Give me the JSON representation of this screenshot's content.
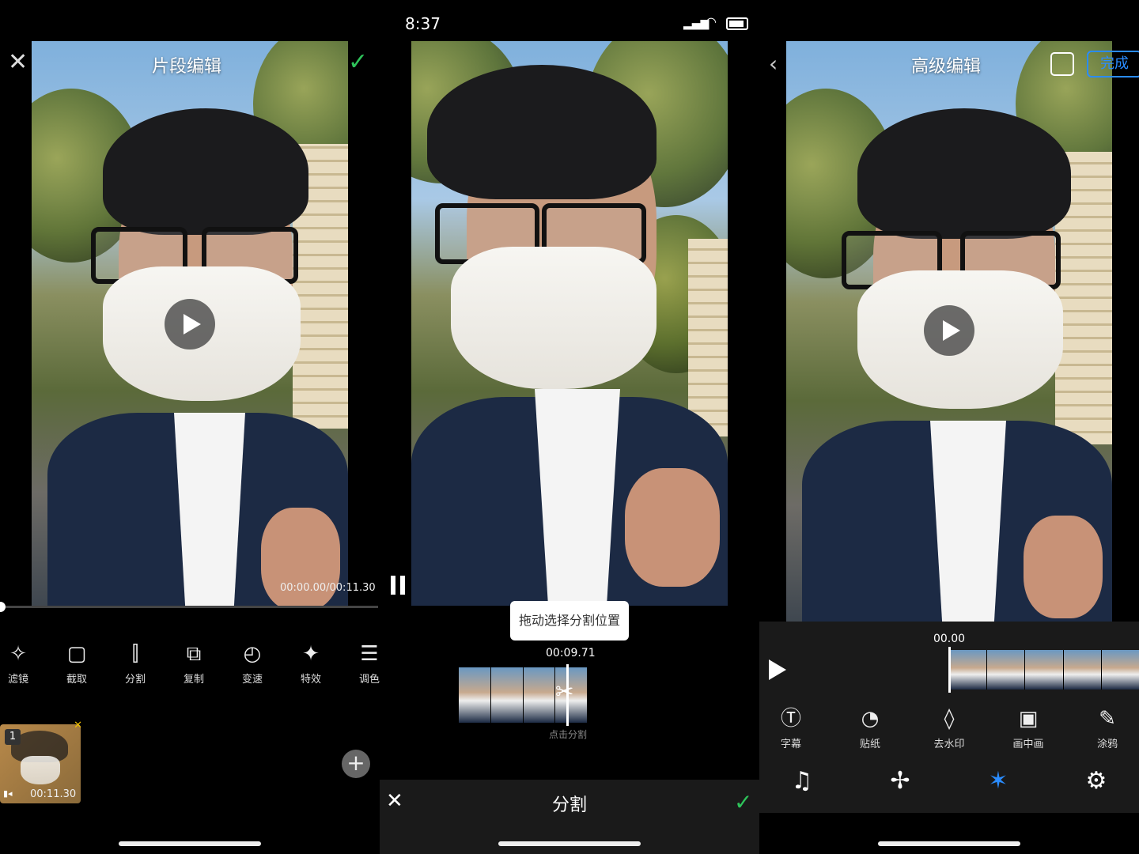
{
  "panel1": {
    "title": "片段编辑",
    "close_icon": "close-icon",
    "confirm_icon": "check-icon",
    "timecode": "00:00.00/00:11.30",
    "progress": 0.0,
    "tools": [
      {
        "label": "滤镜",
        "icon": "filter-wand-icon",
        "glyph": "✧"
      },
      {
        "label": "截取",
        "icon": "crop-icon",
        "glyph": "▢"
      },
      {
        "label": "分割",
        "icon": "split-icon",
        "glyph": "⫿"
      },
      {
        "label": "复制",
        "icon": "copy-icon",
        "glyph": "⧉"
      },
      {
        "label": "变速",
        "icon": "speed-icon",
        "glyph": "◴"
      },
      {
        "label": "特效",
        "icon": "effects-icon",
        "glyph": "✦"
      },
      {
        "label": "调色",
        "icon": "adjust-icon",
        "glyph": "☰"
      }
    ],
    "clip": {
      "index": "1",
      "duration": "00:11.30"
    },
    "add_icon": "plus-icon"
  },
  "panel2": {
    "status_time": "8:37",
    "hint": "拖动选择分割位置",
    "timecode": "00:09.71",
    "tap_hint": "点击分割",
    "title": "分割",
    "close_icon": "close-icon",
    "confirm_icon": "check-icon"
  },
  "panel3": {
    "title": "高级编辑",
    "back_icon": "chevron-left-icon",
    "save_icon": "save-icon",
    "done": "完成",
    "timecode": "00.00",
    "tools": [
      {
        "label": "字幕",
        "icon": "subtitle-icon",
        "glyph": "Ⓣ"
      },
      {
        "label": "贴纸",
        "icon": "sticker-icon",
        "glyph": "◔"
      },
      {
        "label": "去水印",
        "icon": "drop-icon",
        "glyph": "◊"
      },
      {
        "label": "画中画",
        "icon": "pip-icon",
        "glyph": "▣"
      },
      {
        "label": "涂鸦",
        "icon": "brush-icon",
        "glyph": "✎"
      }
    ],
    "bottom_tabs": [
      {
        "icon": "music-icon",
        "glyph": "♫",
        "active": false
      },
      {
        "icon": "transition-icon",
        "glyph": "✢",
        "active": false
      },
      {
        "icon": "magic-wand-icon",
        "glyph": "✶",
        "active": true
      },
      {
        "icon": "settings-icon",
        "glyph": "⚙",
        "active": false
      }
    ]
  },
  "colors": {
    "accent_green": "#2ec35a",
    "accent_blue": "#2a8cff",
    "panel_gray": "#1a1a1a"
  }
}
